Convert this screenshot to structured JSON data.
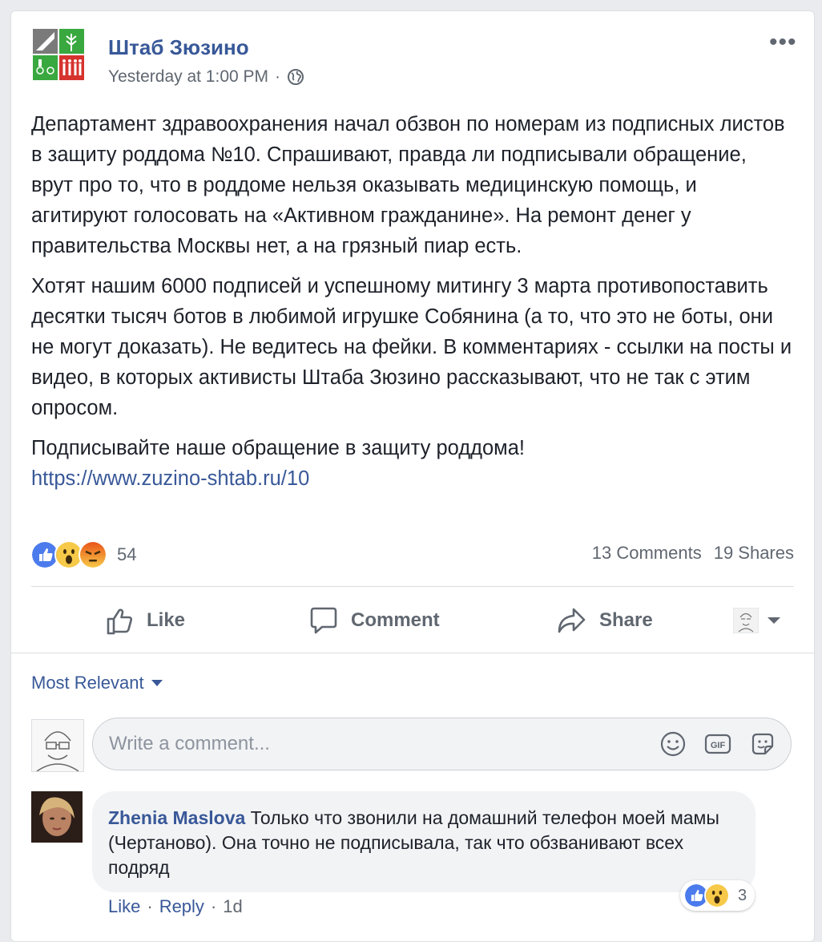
{
  "post": {
    "page_name": "Штаб Зюзино",
    "time": "Yesterday at 1:00 PM",
    "dot": "·",
    "more": "•••",
    "paragraphs": [
      "Департамент здравоохранения начал обзвон по номерам из подписных листов в защиту роддома №10. Спрашивают, правда ли подписывали обращение, врут про то, что в роддоме нельзя оказывать медицинскую помощь, и агитируют голосовать на «Активном гражданине». На ремонт денег у правительства Москвы нет, а на грязный пиар есть.",
      "Хотят нашим 6000 подписей и успешному митингу 3 марта противопоставить десятки тысяч ботов в любимой игрушке Собянина (а то, что это не боты, они не могут доказать). Не ведитесь на фейки. В комментариях - ссылки на посты и видео, в которых активисты Штаба Зюзино рассказывают, что не так с этим опросом.",
      "Подписывайте наше обращение в защиту роддома!"
    ],
    "link": "https://www.zuzino-shtab.ru/10",
    "reaction_count": "54",
    "comments_count": "13 Comments",
    "shares_count": "19 Shares"
  },
  "actions": {
    "like": "Like",
    "comment": "Comment",
    "share": "Share"
  },
  "comments": {
    "sort_label": "Most Relevant",
    "composer_placeholder": "Write a comment...",
    "items": [
      {
        "author": "Zhenia Maslova",
        "text": "Только что звонили на домашний телефон моей мамы (Чертаново). Она точно не подписывала, так что обзванивают всех подряд",
        "reaction_count": "3",
        "like": "Like",
        "reply": "Reply",
        "age": "1d",
        "dot": "·"
      }
    ]
  },
  "colors": {
    "link": "#385898",
    "like_blue": "#1877f2",
    "wow_yellow": "#f7b928",
    "angry_orange": "#e9710f"
  }
}
